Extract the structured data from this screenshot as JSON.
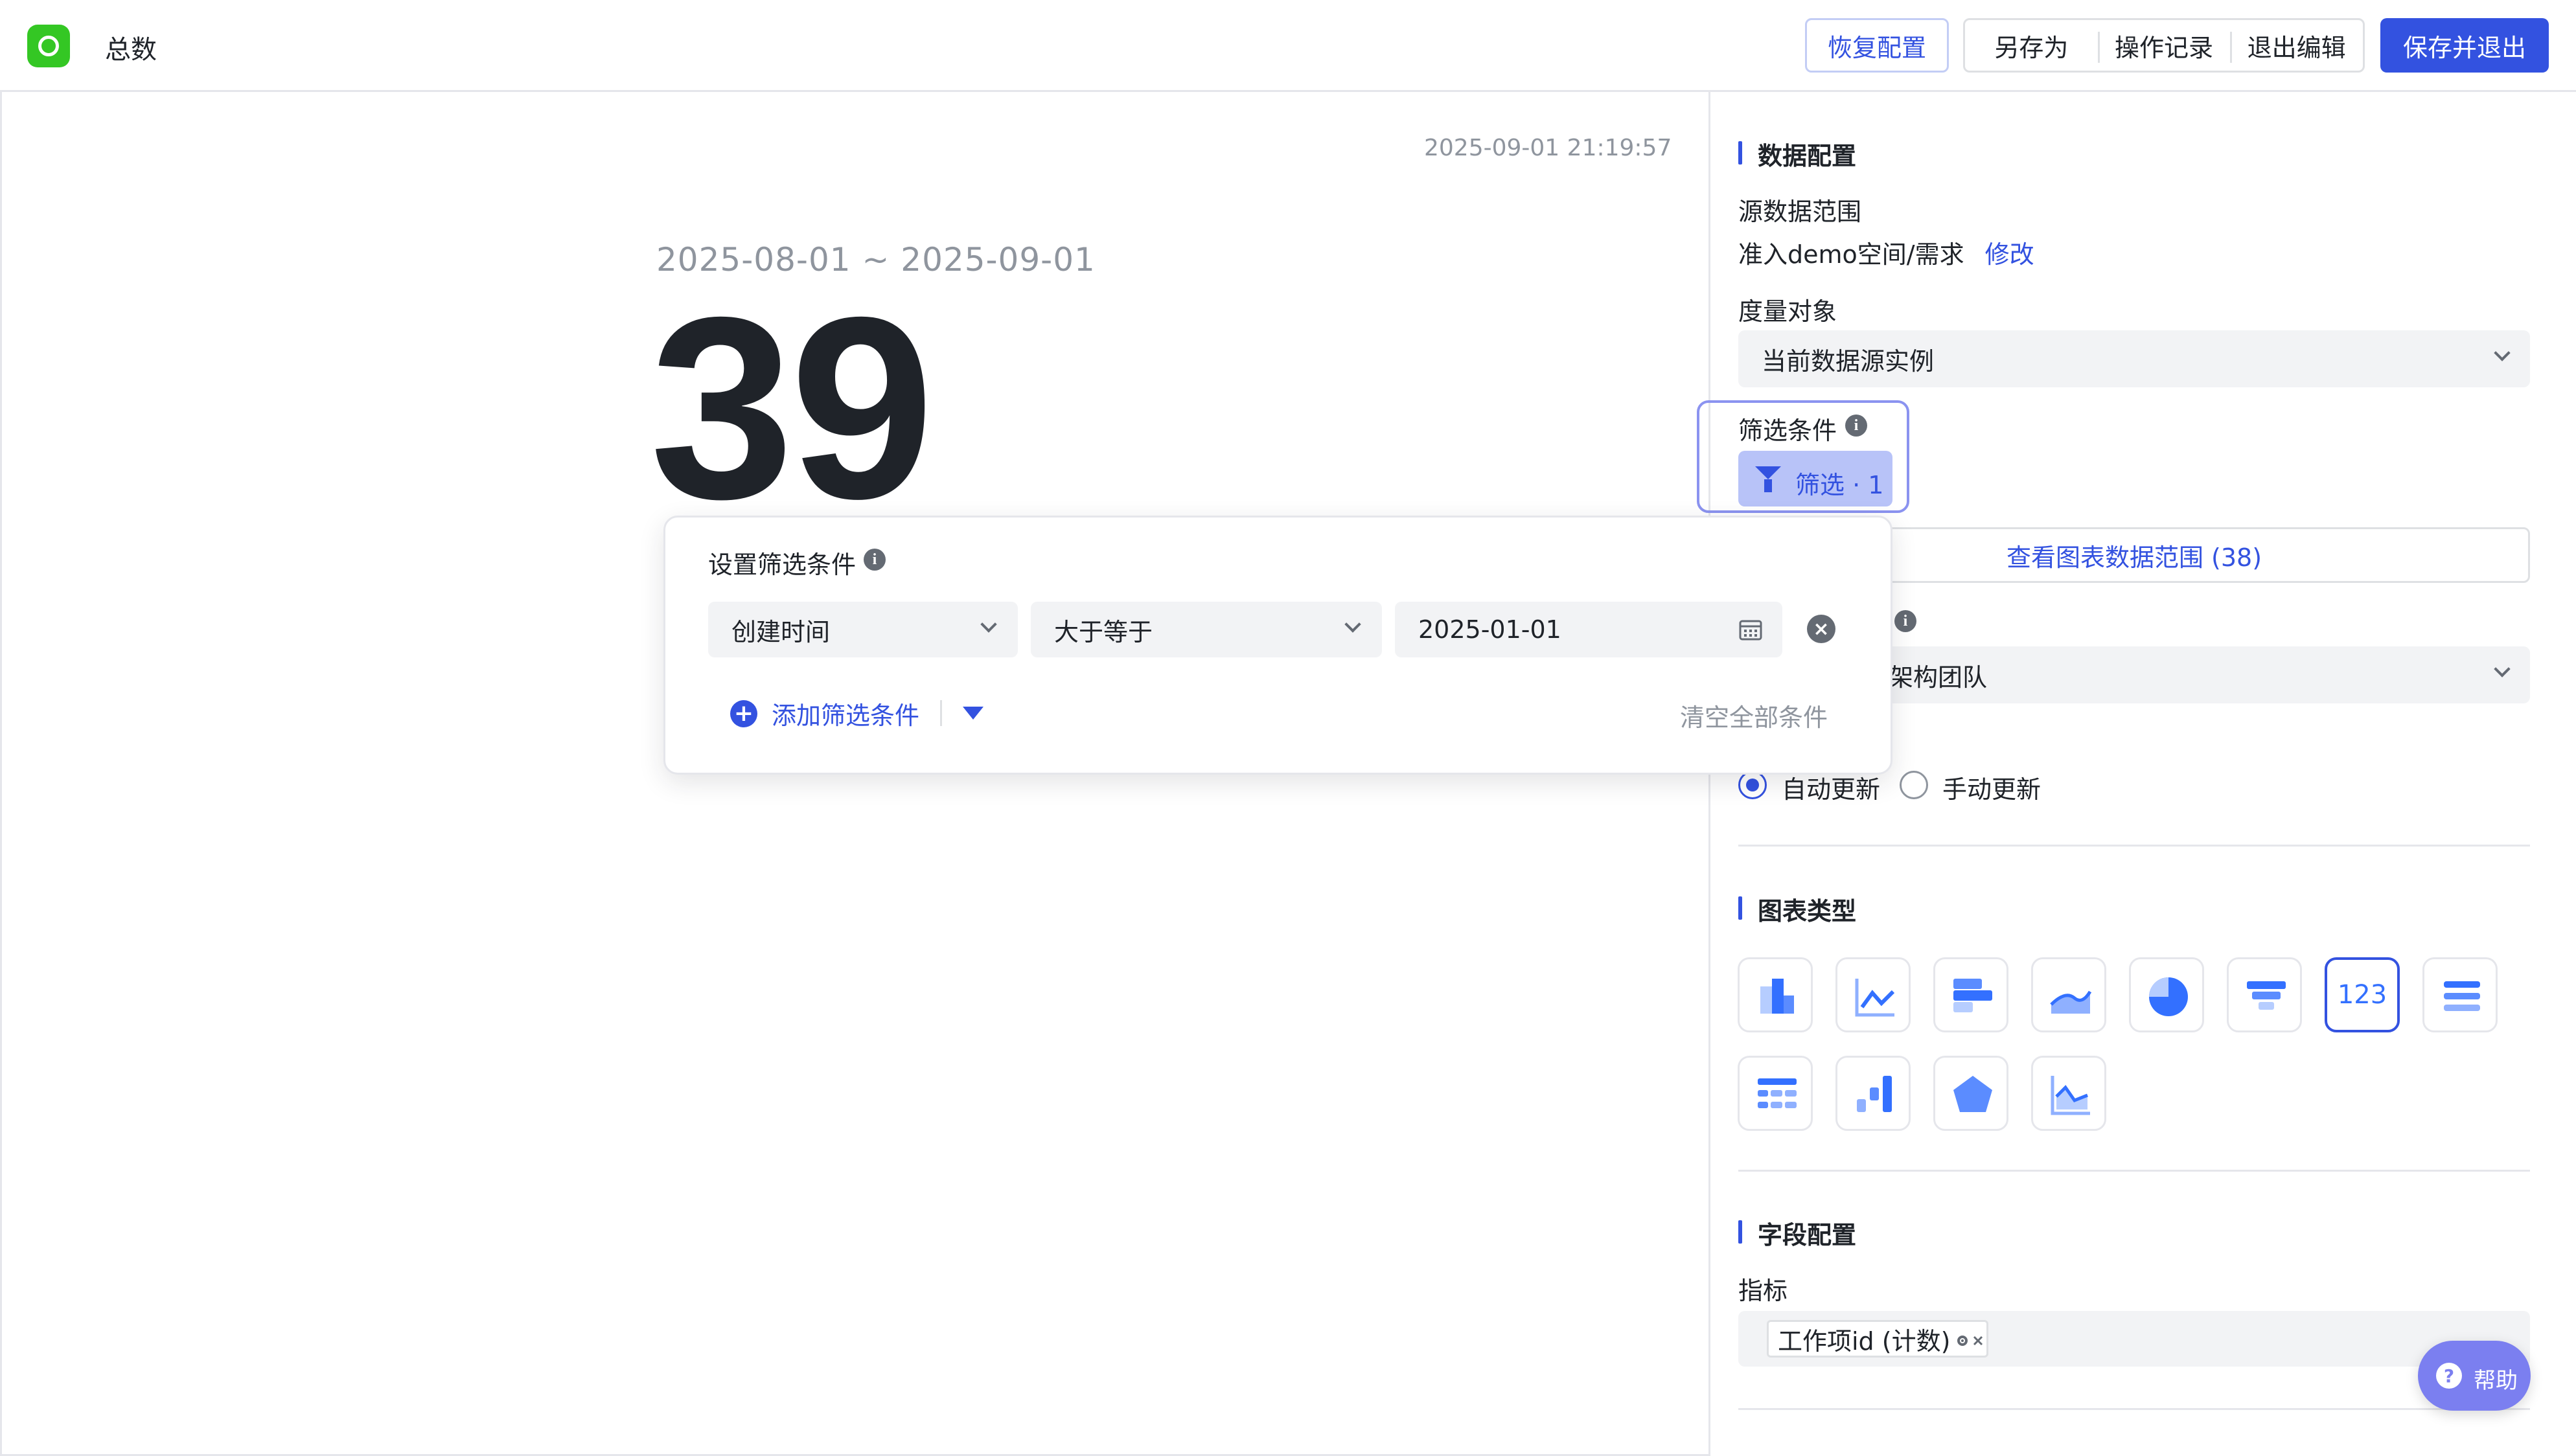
{
  "header": {
    "title": "总数",
    "restore_label": "恢复配置",
    "save_as_label": "另存为",
    "history_label": "操作记录",
    "exit_edit_label": "退出编辑",
    "save_exit_label": "保存并退出"
  },
  "canvas": {
    "timestamp": "2025-09-01 21:19:57",
    "date_range": "2025-08-01 ~ 2025-09-01",
    "total_value": "39"
  },
  "panel": {
    "data_config_title": "数据配置",
    "source_label": "源数据范围",
    "source_value": "准入demo空间/需求",
    "source_modify": "修改",
    "measure_label": "度量对象",
    "measure_value": "当前数据源实例",
    "filter_label": "筛选条件",
    "filter_button": "筛选 · 1",
    "view_range_button": "查看图表数据范围 (38)",
    "team_value_partial": "架构团队",
    "update_auto": "自动更新",
    "update_manual": "手动更新",
    "chart_type_title": "图表类型",
    "chart_types": [
      "bar",
      "line",
      "horizontal-bar",
      "area",
      "pie",
      "funnel",
      "number",
      "list",
      "table",
      "waterfall",
      "radar",
      "line-area"
    ],
    "number_tile_label": "123",
    "field_config_title": "字段配置",
    "metric_label": "指标",
    "metric_tag": "工作项id (计数)"
  },
  "popover": {
    "title": "设置筛选条件",
    "field": "创建时间",
    "operator": "大于等于",
    "value": "2025-01-01",
    "add_filter": "添加筛选条件",
    "clear_all": "清空全部条件"
  },
  "help": {
    "label": "帮助"
  },
  "colors": {
    "accent": "#3352e0",
    "brand_green": "#34c724",
    "help_purple": "#7b7ff0"
  }
}
